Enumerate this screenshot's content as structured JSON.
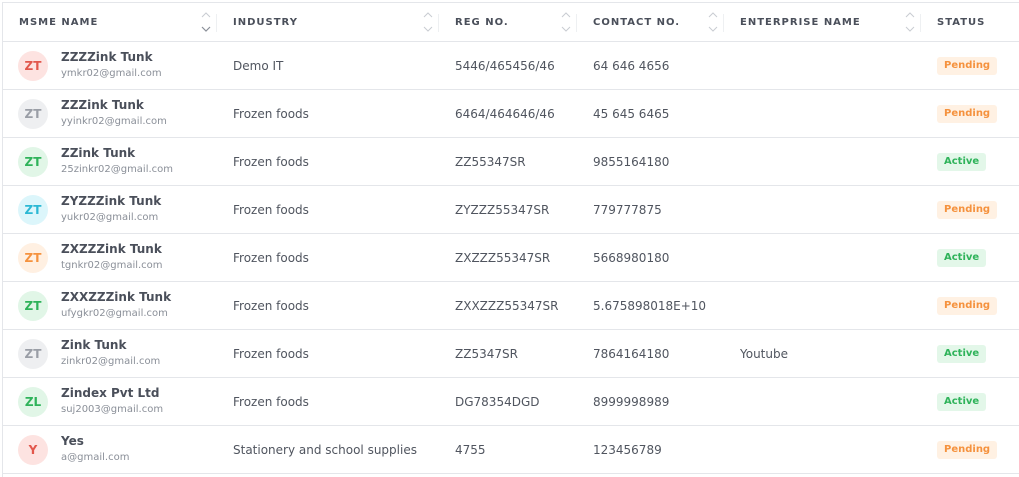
{
  "columns": [
    {
      "key": "name",
      "label": "MSME NAME"
    },
    {
      "key": "industry",
      "label": "INDUSTRY"
    },
    {
      "key": "reg",
      "label": "REG NO."
    },
    {
      "key": "contact",
      "label": "CONTACT NO."
    },
    {
      "key": "enterprise",
      "label": "ENTERPRISE NAME"
    },
    {
      "key": "status",
      "label": "STATUS"
    }
  ],
  "status_colors": {
    "Pending": {
      "text": "#f5923e",
      "bg": "#fff1e3"
    },
    "Active": {
      "text": "#2fb35a",
      "bg": "#e3f7e9"
    }
  },
  "rows": [
    {
      "initials": "ZT",
      "avatar_text": "#e2574c",
      "avatar_bg": "#fde3e1",
      "name": "ZZZZink Tunk",
      "email": "ymkr02@gmail.com",
      "industry": "Demo IT",
      "reg": "5446/465456/46",
      "contact": "64 646 4656",
      "enterprise": "",
      "status": "Pending"
    },
    {
      "initials": "ZT",
      "avatar_text": "#9a9ea6",
      "avatar_bg": "#eeeff1",
      "name": "ZZZink Tunk",
      "email": "yyinkr02@gmail.com",
      "industry": "Frozen foods",
      "reg": "6464/464646/46",
      "contact": "45 645 6465",
      "enterprise": "",
      "status": "Pending"
    },
    {
      "initials": "ZT",
      "avatar_text": "#2fb35a",
      "avatar_bg": "#e1f6e7",
      "name": "ZZink Tunk",
      "email": "25zinkr02@gmail.com",
      "industry": "Frozen foods",
      "reg": "ZZ55347SR",
      "contact": "9855164180",
      "enterprise": "",
      "status": "Active"
    },
    {
      "initials": "ZT",
      "avatar_text": "#2bb8d4",
      "avatar_bg": "#dcf6fb",
      "name": "ZYZZZink Tunk",
      "email": "yukr02@gmail.com",
      "industry": "Frozen foods",
      "reg": "ZYZZZ55347SR",
      "contact": "779777875",
      "enterprise": "",
      "status": "Pending"
    },
    {
      "initials": "ZT",
      "avatar_text": "#f5923e",
      "avatar_bg": "#fff0e2",
      "name": "ZXZZZink Tunk",
      "email": "tgnkr02@gmail.com",
      "industry": "Frozen foods",
      "reg": "ZXZZZ55347SR",
      "contact": "5668980180",
      "enterprise": "",
      "status": "Active"
    },
    {
      "initials": "ZT",
      "avatar_text": "#2fb35a",
      "avatar_bg": "#e1f6e7",
      "name": "ZXXZZZink Tunk",
      "email": "ufygkr02@gmail.com",
      "industry": "Frozen foods",
      "reg": "ZXXZZZ55347SR",
      "contact": "5.675898018E+10",
      "enterprise": "",
      "status": "Pending"
    },
    {
      "initials": "ZT",
      "avatar_text": "#9a9ea6",
      "avatar_bg": "#eeeff1",
      "name": "Zink Tunk",
      "email": "zinkr02@gmail.com",
      "industry": "Frozen foods",
      "reg": "ZZ5347SR",
      "contact": "7864164180",
      "enterprise": "Youtube",
      "status": "Active"
    },
    {
      "initials": "ZL",
      "avatar_text": "#2fb35a",
      "avatar_bg": "#e1f6e7",
      "name": "Zindex Pvt Ltd",
      "email": "suj2003@gmail.com",
      "industry": "Frozen foods",
      "reg": "DG78354DGD",
      "contact": "8999998989",
      "enterprise": "",
      "status": "Active"
    },
    {
      "initials": "Y",
      "avatar_text": "#e2574c",
      "avatar_bg": "#fde3e1",
      "name": "Yes",
      "email": "a@gmail.com",
      "industry": "Stationery and school supplies",
      "reg": "4755",
      "contact": "123456789",
      "enterprise": "",
      "status": "Pending"
    }
  ]
}
